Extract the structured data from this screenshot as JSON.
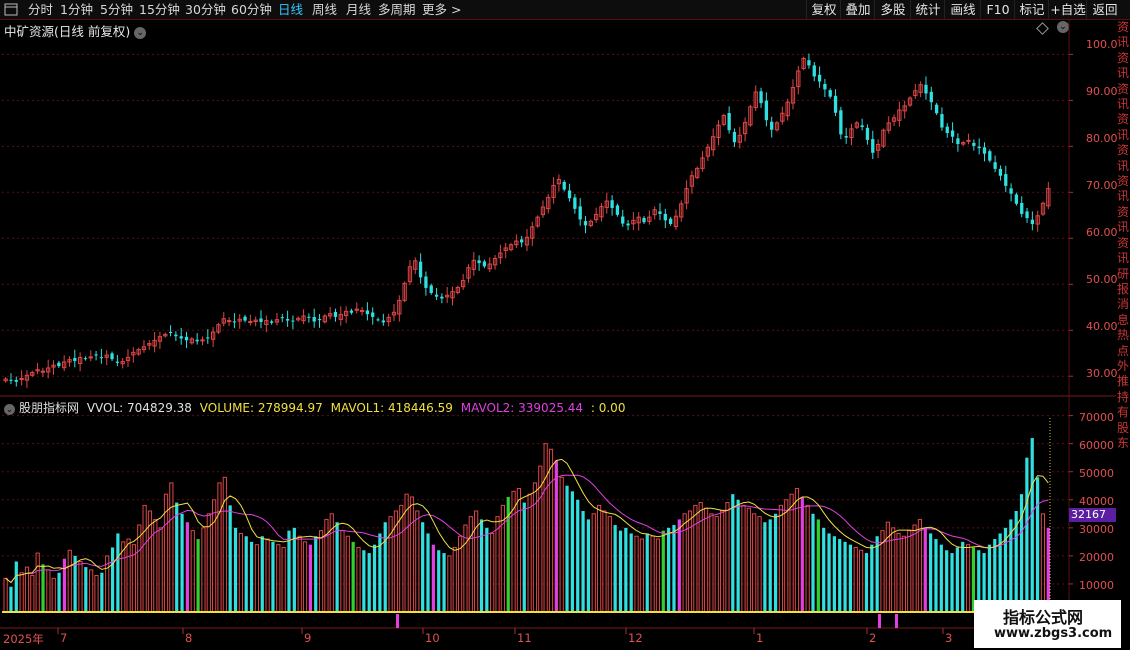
{
  "toolbar": {
    "periods": [
      "分时",
      "1分钟",
      "5分钟",
      "15分钟",
      "30分钟",
      "60分钟",
      "日线",
      "周线",
      "月线",
      "多周期",
      "更多 >"
    ],
    "active_period": "日线",
    "right_buttons": [
      "复权",
      "叠加",
      "多股",
      "统计",
      "画线",
      "F10",
      "标记",
      "+自选",
      "返回"
    ]
  },
  "chart_title": "中矿资源(日线 前复权)",
  "chart_title_icon": "chevron-down-icon",
  "price_axis": {
    "ticks": [
      "100.0",
      "90.00",
      "80.00",
      "70.00",
      "60.00",
      "50.00",
      "40.00",
      "30.00"
    ]
  },
  "indicator": {
    "name": "股朋指标网",
    "vvol_label": "VVOL: 704829.38",
    "volume_label": "VOLUME: 278994.97",
    "mavol1_label": "MAVOL1: 418446.59",
    "mavol2_label": "MAVOL2: 339025.44",
    "extra_label": ": 0.00",
    "axis_ticks": [
      "70000",
      "60000",
      "50000",
      "40000",
      "30000",
      "20000",
      "10000"
    ],
    "current_value": "32167"
  },
  "x_axis": {
    "labels": [
      "2025年",
      "7",
      "8",
      "9",
      "10",
      "11",
      "12",
      "1",
      "2",
      "3"
    ]
  },
  "right_strip_text": "资讯资讯资讯资讯资讯资讯资讯资讯研报消息热点外推持有股东",
  "watermark": {
    "line1": "指标公式网",
    "line2": "www.zbgs3.com"
  },
  "colors": {
    "up": "#e04646",
    "down": "#30e0e0",
    "ma1": "#f0e040",
    "ma2": "#e040e0",
    "grid": "#5a1010"
  },
  "chart_data": [
    {
      "type": "candlestick",
      "title": "中矿资源(日线 前复权)",
      "ylim": [
        27,
        104
      ],
      "close": [
        29.4,
        29,
        28.8,
        29.5,
        30.2,
        30.8,
        31.4,
        31.1,
        31.8,
        32.4,
        32.2,
        33.1,
        33.6,
        33.3,
        34.1,
        33.8,
        34.2,
        34.5,
        34.1,
        34.6,
        33.7,
        32.9,
        33.2,
        34.1,
        35.2,
        35.8,
        36.4,
        37.1,
        37.8,
        38.6,
        39.1,
        39.4,
        38.7,
        38.2,
        37.8,
        38.1,
        37.6,
        37.9,
        38.4,
        39.6,
        41.2,
        42.5,
        42.1,
        41.8,
        42.4,
        42.1,
        41.9,
        42.2,
        41.8,
        42.1,
        41.6,
        42.3,
        42.8,
        42.1,
        41.9,
        42.6,
        43.1,
        42.7,
        41.9,
        42.2,
        43.1,
        43.6,
        42.9,
        43.4,
        44.1,
        43.8,
        44.6,
        44.3,
        43.5,
        42.9,
        42.3,
        41.7,
        42.8,
        43.9,
        46.5,
        50.2,
        53.8,
        55.1,
        51.5,
        49.2,
        48.1,
        47.3,
        46.9,
        47.6,
        48.4,
        49.3,
        50.8,
        53.6,
        55.2,
        54.6,
        53.9,
        54.4,
        55.6,
        56.8,
        57.9,
        58.6,
        59.4,
        59.1,
        60.2,
        62.5,
        64.6,
        66.8,
        68.9,
        71.5,
        72.8,
        70.6,
        68.7,
        66.4,
        64.1,
        62.8,
        63.7,
        65.2,
        66.9,
        68.1,
        66.6,
        65.1,
        63.2,
        62.8,
        63.9,
        64.6,
        63.5,
        64.6,
        66.2,
        65.3,
        63.9,
        63.1,
        64.8,
        67.5,
        70.8,
        73.6,
        75.2,
        77.5,
        79.8,
        82.1,
        84.6,
        86.7,
        83.5,
        80.9,
        82.4,
        85.2,
        88.6,
        91.8,
        89.4,
        85.7,
        83.6,
        85.1,
        87.2,
        89.6,
        92.8,
        96.4,
        99.1,
        97.6,
        95.2,
        94.1,
        92.4,
        90.8,
        87.3,
        82.6,
        81.9,
        83.8,
        85.1,
        84.2,
        81.4,
        78.6,
        80.4,
        83.5,
        85.1,
        86.2,
        87.9,
        88.8,
        90.5,
        92.1,
        93.4,
        91.5,
        89.6,
        87.2,
        84.1,
        82.9,
        82.1,
        80.5,
        80.8,
        81.3,
        80.1,
        79.6,
        78.4,
        76.9,
        75.1,
        73.6,
        71.4,
        69.7,
        67.5,
        65.3,
        64.4,
        63.1,
        64.9,
        67.6,
        70.8
      ]
    },
    {
      "type": "bar",
      "title": "股朋指标网",
      "ylim": [
        0,
        72000
      ],
      "series": [
        {
          "name": "VOLUME",
          "values": [
            12000,
            9000,
            18000,
            14000,
            16000,
            13000,
            21000,
            17000,
            15000,
            12000,
            14000,
            19000,
            22000,
            20000,
            18000,
            16000,
            15000,
            13000,
            14000,
            20000,
            23000,
            28000,
            25000,
            26000,
            24000,
            31000,
            38000,
            36000,
            33000,
            30000,
            42000,
            46000,
            39000,
            35000,
            32000,
            29000,
            26000,
            30000,
            35000,
            40000,
            46000,
            48000,
            38000,
            30000,
            28000,
            27000,
            25000,
            24000,
            27000,
            26000,
            25000,
            24000,
            23000,
            29000,
            30000,
            27000,
            25000,
            24000,
            27000,
            29000,
            33000,
            35000,
            32000,
            29000,
            27000,
            25000,
            23000,
            22000,
            21000,
            24000,
            28000,
            32000,
            34000,
            36000,
            38000,
            42000,
            41000,
            36000,
            32000,
            28000,
            24000,
            22000,
            21000,
            20000,
            23000,
            27000,
            31000,
            34000,
            36000,
            33000,
            30000,
            28000,
            34000,
            38000,
            41000,
            43000,
            44000,
            39000,
            42000,
            46000,
            52000,
            60000,
            58000,
            54000,
            48000,
            45000,
            43000,
            40000,
            36000,
            33000,
            35000,
            38000,
            36000,
            34000,
            31000,
            29000,
            30000,
            28000,
            27000,
            26000,
            28000,
            27000,
            26000,
            29000,
            30000,
            31000,
            33000,
            35000,
            36000,
            38000,
            39000,
            37000,
            35000,
            34000,
            36000,
            39000,
            42000,
            40000,
            38000,
            37000,
            35000,
            34000,
            32000,
            33000,
            35000,
            38000,
            40000,
            42000,
            44000,
            41000,
            38000,
            35000,
            33000,
            30000,
            28000,
            27000,
            26000,
            25000,
            24000,
            23000,
            22000,
            21000,
            24000,
            27000,
            29000,
            32000,
            30000,
            28000,
            27000,
            29000,
            31000,
            33000,
            30000,
            28000,
            26000,
            24000,
            22000,
            21000,
            23000,
            25000,
            24000,
            23000,
            22000,
            21000,
            24000,
            26000,
            28000,
            30000,
            33000,
            36000,
            42000,
            55000,
            62000,
            48000,
            35000,
            30000
          ]
        }
      ]
    }
  ]
}
